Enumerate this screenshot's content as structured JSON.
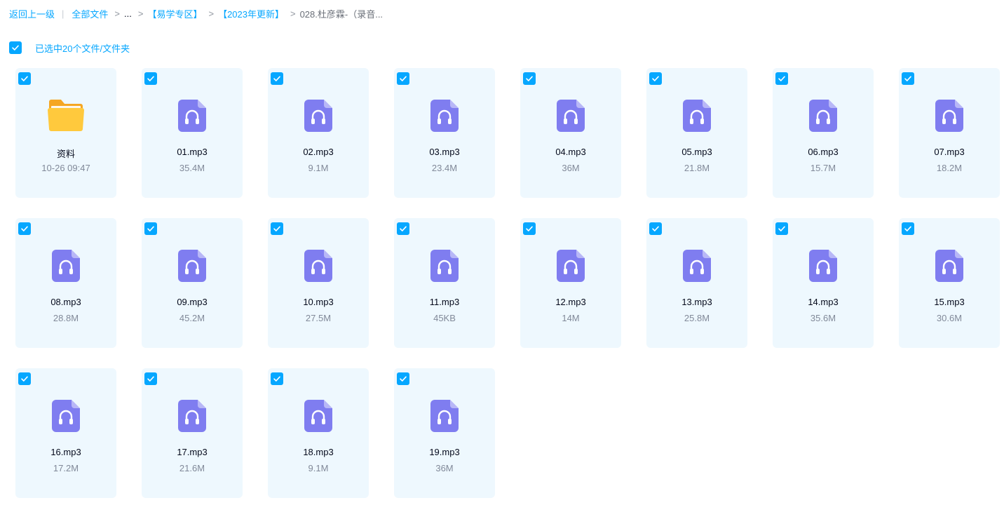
{
  "breadcrumb": {
    "back_label": "返回上一级",
    "divider": "|",
    "items": [
      "全部文件",
      "...",
      "【易学专区】",
      "【2023年更新】",
      "028.杜彦霖-（录音..."
    ],
    "separator": ">"
  },
  "selection": {
    "checked": true,
    "label": "已选中20个文件/文件夹"
  },
  "files": [
    {
      "name": "资料",
      "meta": "10-26 09:47",
      "type": "folder",
      "checked": true
    },
    {
      "name": "01.mp3",
      "meta": "35.4M",
      "type": "audio",
      "checked": true
    },
    {
      "name": "02.mp3",
      "meta": "9.1M",
      "type": "audio",
      "checked": true
    },
    {
      "name": "03.mp3",
      "meta": "23.4M",
      "type": "audio",
      "checked": true
    },
    {
      "name": "04.mp3",
      "meta": "36M",
      "type": "audio",
      "checked": true
    },
    {
      "name": "05.mp3",
      "meta": "21.8M",
      "type": "audio",
      "checked": true
    },
    {
      "name": "06.mp3",
      "meta": "15.7M",
      "type": "audio",
      "checked": true
    },
    {
      "name": "07.mp3",
      "meta": "18.2M",
      "type": "audio",
      "checked": true
    },
    {
      "name": "08.mp3",
      "meta": "28.8M",
      "type": "audio",
      "checked": true
    },
    {
      "name": "09.mp3",
      "meta": "45.2M",
      "type": "audio",
      "checked": true
    },
    {
      "name": "10.mp3",
      "meta": "27.5M",
      "type": "audio",
      "checked": true
    },
    {
      "name": "11.mp3",
      "meta": "45KB",
      "type": "audio",
      "checked": true
    },
    {
      "name": "12.mp3",
      "meta": "14M",
      "type": "audio",
      "checked": true
    },
    {
      "name": "13.mp3",
      "meta": "25.8M",
      "type": "audio",
      "checked": true
    },
    {
      "name": "14.mp3",
      "meta": "35.6M",
      "type": "audio",
      "checked": true
    },
    {
      "name": "15.mp3",
      "meta": "30.6M",
      "type": "audio",
      "checked": true
    },
    {
      "name": "16.mp3",
      "meta": "17.2M",
      "type": "audio",
      "checked": true
    },
    {
      "name": "17.mp3",
      "meta": "21.6M",
      "type": "audio",
      "checked": true
    },
    {
      "name": "18.mp3",
      "meta": "9.1M",
      "type": "audio",
      "checked": true
    },
    {
      "name": "19.mp3",
      "meta": "36M",
      "type": "audio",
      "checked": true
    }
  ],
  "icons": {
    "checkbox": "check-icon",
    "folder": "folder-icon",
    "audio": "audio-file-icon"
  },
  "colors": {
    "accent": "#06a7ff",
    "card_bg": "#eef8fe",
    "audio_icon": "#7f7df0",
    "folder": "#ffc93d"
  }
}
